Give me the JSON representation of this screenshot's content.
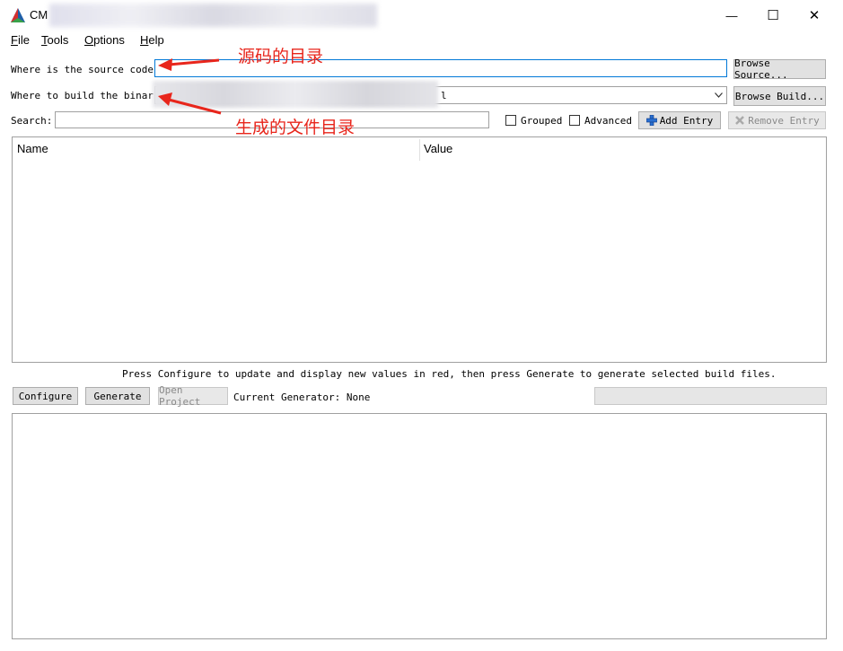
{
  "window": {
    "title": "CM",
    "minimize_glyph": "—",
    "maximize_glyph": "☐",
    "close_glyph": "✕"
  },
  "menu": [
    {
      "label": "File"
    },
    {
      "label": "Tools"
    },
    {
      "label": "Options"
    },
    {
      "label": "Help"
    }
  ],
  "source": {
    "label": "Where is the source code:",
    "value": "",
    "browse_label": "Browse Source..."
  },
  "build": {
    "label": "Where to build the binaris",
    "value_visible": "l",
    "browse_label": "Browse Build..."
  },
  "search": {
    "label": "Search:",
    "value": ""
  },
  "options": {
    "grouped_label": "Grouped",
    "grouped_checked": false,
    "advanced_label": "Advanced",
    "advanced_checked": false,
    "add_entry_label": "Add Entry",
    "remove_entry_label": "Remove Entry"
  },
  "table": {
    "columns": [
      "Name",
      "Value"
    ],
    "rows": []
  },
  "hint_text": "Press Configure to update and display new values in red, then press Generate to generate selected build files.",
  "actions": {
    "configure_label": "Configure",
    "generate_label": "Generate",
    "open_project_label": "Open Project",
    "generator_text": "Current Generator: None"
  },
  "annotations": {
    "source_note": "源码的目录",
    "build_note": "生成的文件目录",
    "color": "#e8261c"
  },
  "colors": {
    "accent": "#0078d7",
    "annotation_red": "#e8261c"
  }
}
